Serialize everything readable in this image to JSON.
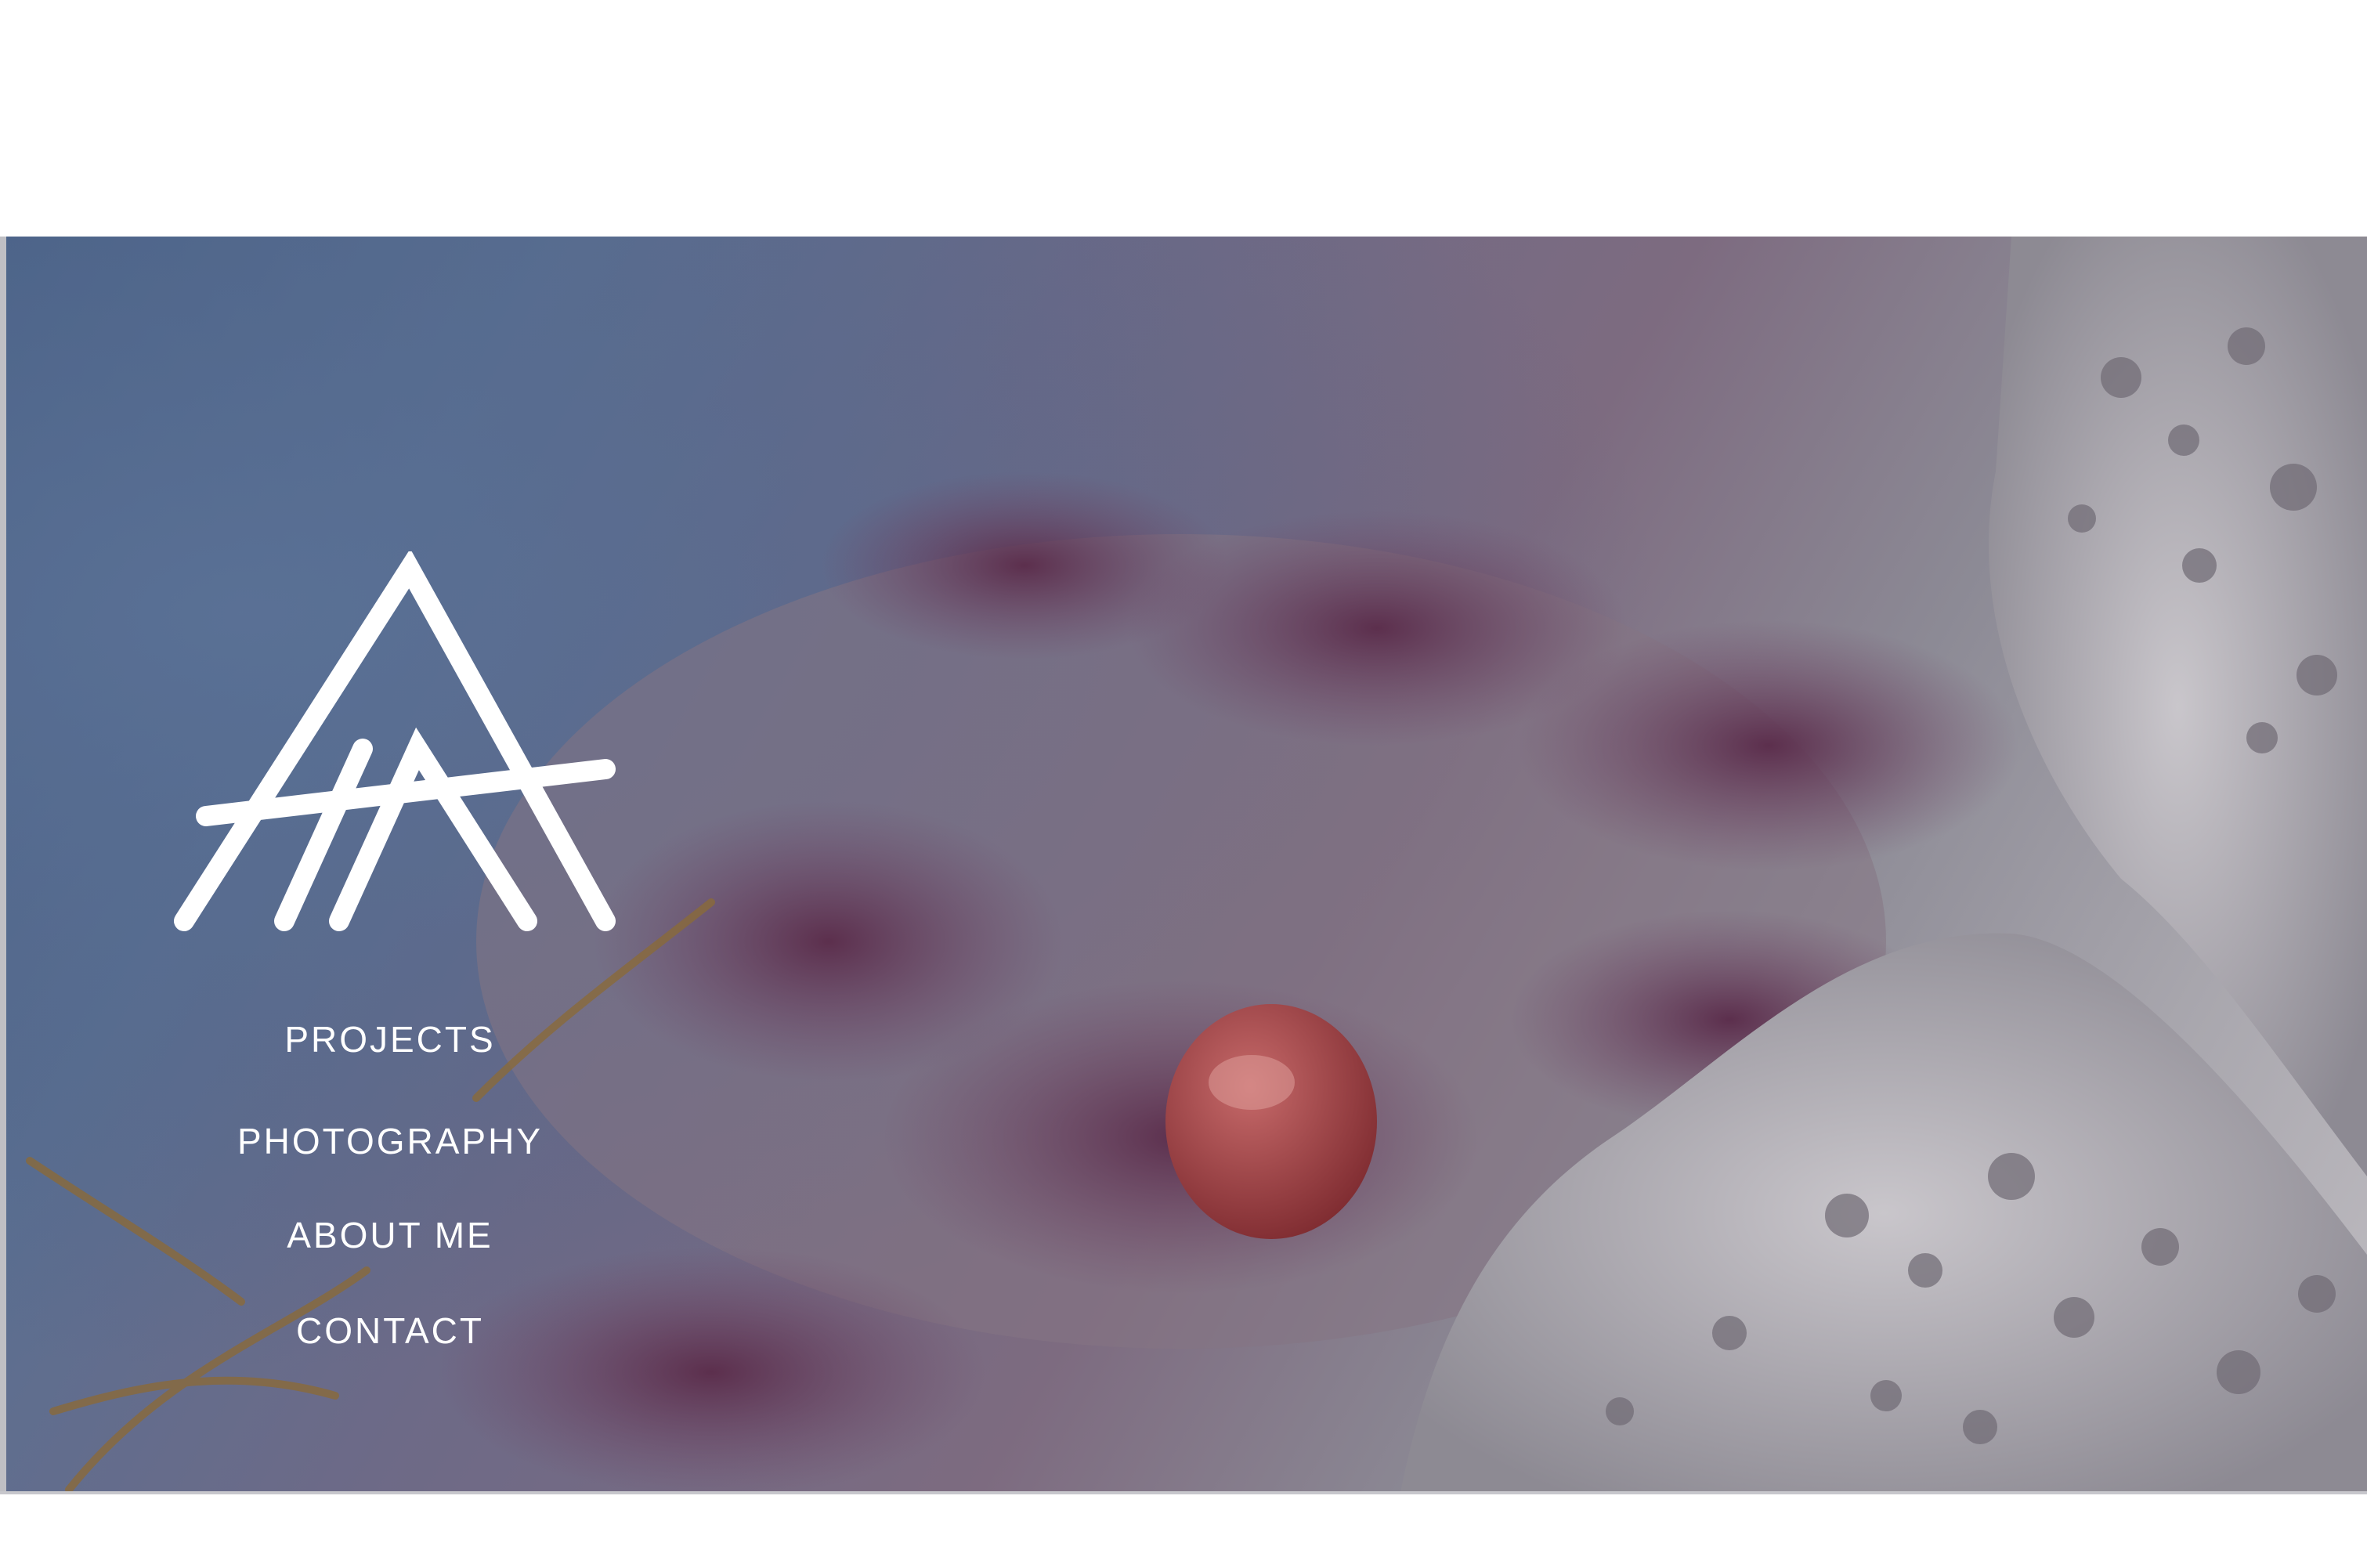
{
  "nav": {
    "items": [
      {
        "label": "PROJECTS"
      },
      {
        "label": "PHOTOGRAPHY"
      },
      {
        "label": "ABOUT ME"
      },
      {
        "label": "CONTACT"
      }
    ]
  },
  "logo": {
    "icon": "aa-monogram-logo",
    "color": "#ffffff"
  },
  "hero": {
    "image": "rock-pool-seaweed-photo",
    "colors": {
      "water": "#4f6489",
      "seaweed": "#6b3f5e",
      "rock": "#b8b5bc",
      "red_stone": "#9a3a3c"
    }
  }
}
